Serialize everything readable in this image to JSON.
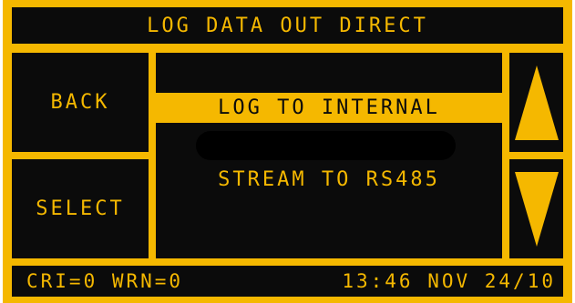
{
  "colors": {
    "accent": "#f5b800",
    "background": "#0b0b0b"
  },
  "header": {
    "title": "LOG DATA OUT DIRECT"
  },
  "buttons": {
    "back": "BACK",
    "select": "SELECT"
  },
  "options": {
    "items": [
      {
        "label": "LOG TO INTERNAL",
        "selected": true
      },
      {
        "label": "",
        "redacted": true
      },
      {
        "label": "STREAM TO RS485",
        "selected": false
      }
    ]
  },
  "icons": {
    "up": "arrow-up-icon",
    "down": "arrow-down-icon"
  },
  "status": {
    "left": "CRI=0 WRN=0",
    "right": "13:46 NOV 24/10"
  }
}
